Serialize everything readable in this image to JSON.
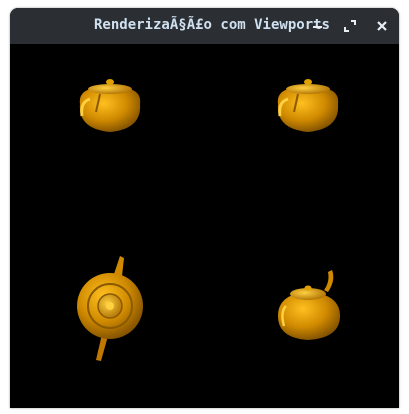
{
  "window": {
    "title": "RenderizaÃ§Ã£o com Viewports",
    "controls": {
      "minimize_icon": "minimize-icon",
      "maximize_icon": "maximize-icon",
      "close_icon": "close-icon"
    }
  },
  "colors": {
    "titlebar": "#2b2f33",
    "title_text": "#cfe0f0",
    "viewport_background": "#000000",
    "teapot_base": "#d08a00",
    "teapot_highlight": "#ffc020",
    "teapot_shadow": "#7a4c00"
  },
  "viewports": [
    {
      "view": "front"
    },
    {
      "view": "front"
    },
    {
      "view": "top"
    },
    {
      "view": "perspective"
    }
  ]
}
